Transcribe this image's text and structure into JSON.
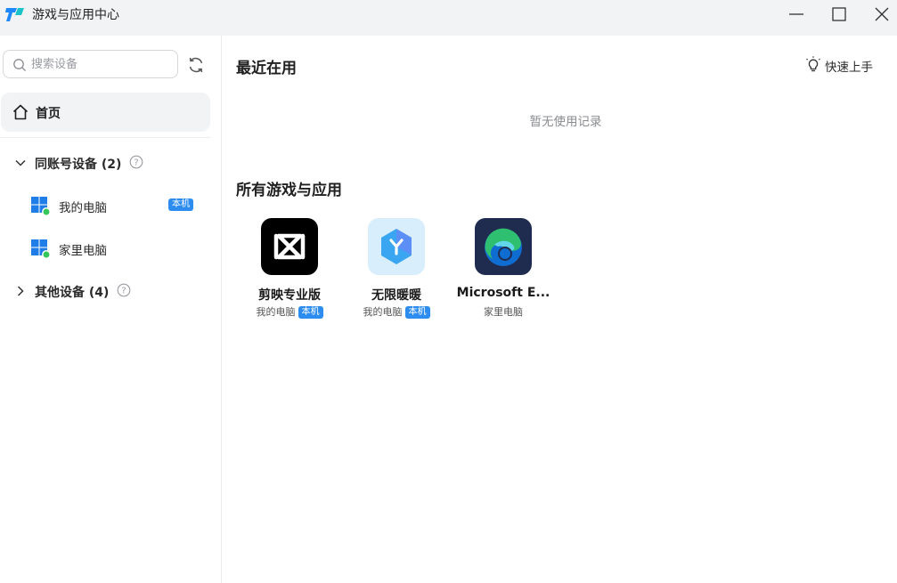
{
  "window": {
    "title": "游戏与应用中心",
    "icons": {
      "logo": "app-logo-icon",
      "minimize": "minimize-icon",
      "maximize": "maximize-icon",
      "close": "close-icon"
    }
  },
  "sidebar": {
    "search": {
      "placeholder": "搜索设备",
      "value": ""
    },
    "home": {
      "label": "首页"
    },
    "groups": [
      {
        "label": "同账号设备 (2)",
        "expanded": true,
        "devices": [
          {
            "label": "我的电脑",
            "badge": "本机",
            "online": true
          },
          {
            "label": "家里电脑",
            "badge": "",
            "online": true
          }
        ]
      },
      {
        "label": "其他设备 (4)",
        "expanded": false,
        "devices": []
      }
    ]
  },
  "main": {
    "recent_title": "最近在用",
    "quick_start": "快速上手",
    "empty_text": "暂无使用记录",
    "all_title": "所有游戏与应用",
    "apps": [
      {
        "name": "剪映专业版",
        "device": "我的电脑",
        "badge": "本机",
        "icon": "capcut-icon"
      },
      {
        "name": "无限暖暖",
        "device": "我的电脑",
        "badge": "本机",
        "icon": "infinity-nikki-icon"
      },
      {
        "name": "Microsoft E...",
        "device": "家里电脑",
        "badge": "",
        "icon": "edge-icon"
      }
    ]
  },
  "colors": {
    "accent": "#2d8cf0",
    "online": "#35c75a",
    "titlebar": "#f2f3f5",
    "selected": "#f2f3f5"
  }
}
